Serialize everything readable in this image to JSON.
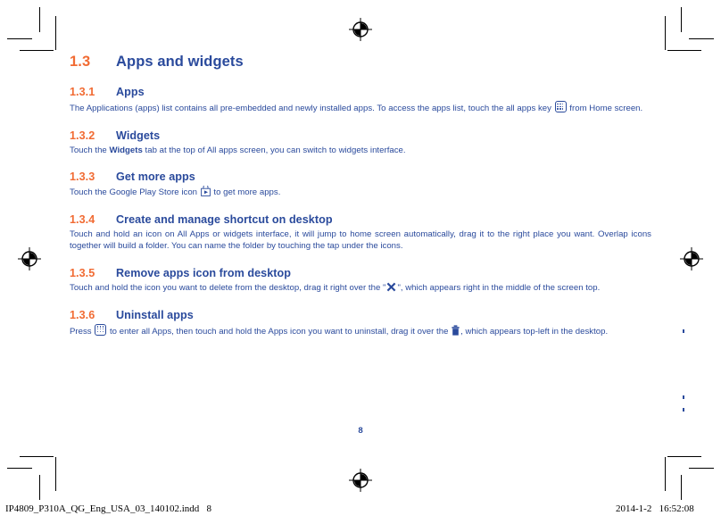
{
  "document": {
    "page_number": "8",
    "heading": {
      "number": "1.3",
      "title": "Apps and widgets"
    },
    "sections": [
      {
        "number": "1.3.1",
        "title": "Apps",
        "body_before": "The Applications (apps) list contains all pre-embedded and newly installed apps. To access the apps list, touch the all apps key ",
        "icon": "all-apps-grid-icon",
        "body_after": " from Home screen."
      },
      {
        "number": "1.3.2",
        "title": "Widgets",
        "body_before": "Touch the ",
        "bold": "Widgets",
        "body_after": " tab at the top of All apps screen, you can switch to widgets interface."
      },
      {
        "number": "1.3.3",
        "title": "Get more apps",
        "body_before": "Touch the Google Play Store icon ",
        "icon": "play-store-icon",
        "body_after": " to get more apps."
      },
      {
        "number": "1.3.4",
        "title": "Create and manage shortcut on desktop",
        "body_before": "Touch and hold an icon on All Apps or widgets interface, it will jump to home screen automatically, drag it to the right place you want. Overlap icons together will build a folder. You can name the folder by touching the tap under the icons.",
        "icon": null,
        "body_after": ""
      },
      {
        "number": "1.3.5",
        "title": "Remove apps icon from desktop",
        "body_before": "Touch and hold the icon you want to delete from the desktop, drag it right over the \"",
        "icon": "remove-cross-icon",
        "body_after": "\", which appears right in the middle of the screen top."
      },
      {
        "number": "1.3.6",
        "title": "Uninstall apps",
        "body_before": "Press ",
        "icon": "all-apps-grid-icon",
        "body_mid": " to enter all Apps, then touch and hold the Apps icon you want to uninstall, drag it over the ",
        "icon2": "trash-bin-icon",
        "body_after": ", which appears top-left in the desktop."
      }
    ]
  },
  "proof_footer": {
    "filename": "IP4809_P310A_QG_Eng_USA_03_140102.indd   8",
    "timestamp": "2014-1-2   16:52:08"
  },
  "print_marks": {
    "registration_marks": [
      "top-center",
      "left-middle",
      "right-middle",
      "bottom-center"
    ],
    "crop_marks": [
      "top-left",
      "top-right",
      "bottom-left",
      "bottom-right"
    ]
  },
  "colors": {
    "heading_blue": "#2A4A9C",
    "number_orange": "#F16B33",
    "body_blue": "#2A4A9C",
    "mark_black": "#000000"
  }
}
